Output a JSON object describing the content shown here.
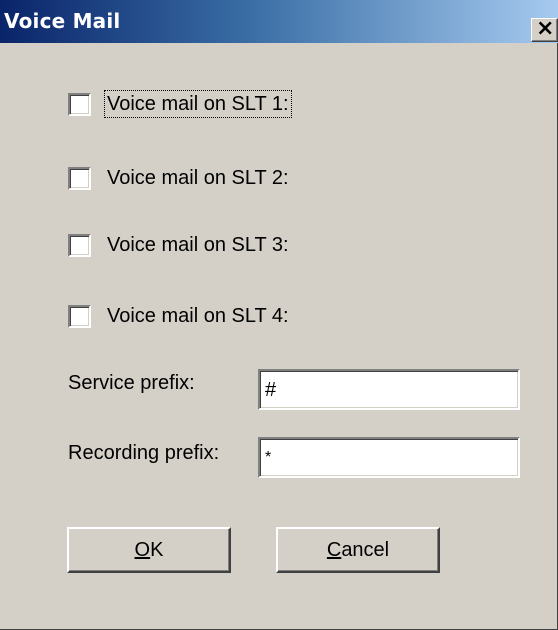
{
  "window": {
    "title": "Voice Mail",
    "close_glyph": "✕"
  },
  "checkboxes": [
    {
      "label": "Voice mail on SLT 1:",
      "checked": false,
      "focused": true
    },
    {
      "label": "Voice mail on SLT 2:",
      "checked": false,
      "focused": false
    },
    {
      "label": "Voice mail on SLT 3:",
      "checked": false,
      "focused": false
    },
    {
      "label": "Voice mail on SLT 4:",
      "checked": false,
      "focused": false
    }
  ],
  "fields": {
    "service_prefix": {
      "label": "Service prefix:",
      "value": "#"
    },
    "recording_prefix": {
      "label": "Recording prefix:",
      "value": "*"
    }
  },
  "buttons": {
    "ok": {
      "mnemonic": "O",
      "rest": "K"
    },
    "cancel": {
      "mnemonic": "C",
      "rest": "ancel"
    }
  }
}
